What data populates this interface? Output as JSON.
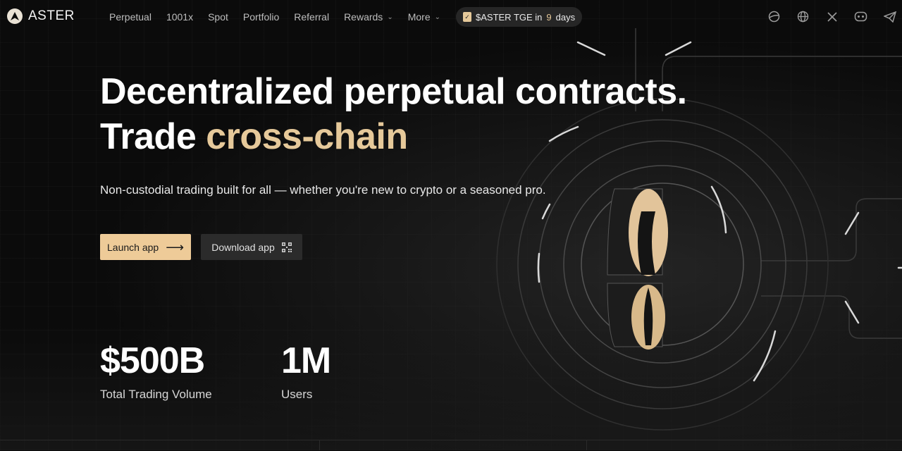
{
  "brand": {
    "name": "ASTER"
  },
  "nav": {
    "items": [
      {
        "label": "Perpetual"
      },
      {
        "label": "1001x"
      },
      {
        "label": "Spot"
      },
      {
        "label": "Portfolio"
      },
      {
        "label": "Referral"
      },
      {
        "label": "Rewards",
        "dropdown": true
      },
      {
        "label": "More",
        "dropdown": true
      }
    ],
    "tge": {
      "prefix": "$ASTER TGE in",
      "count": "9",
      "suffix": "days"
    },
    "icons": [
      "theme-icon",
      "globe-icon",
      "x-icon",
      "discord-icon",
      "telegram-icon"
    ]
  },
  "hero": {
    "line1": "Decentralized perpetual contracts.",
    "line2_prefix": "Trade",
    "line2_highlight": "cross-chain",
    "subtitle": "Non-custodial trading built for all — whether you're new to crypto or a seasoned pro.",
    "launch_label": "Launch app",
    "download_label": "Download app"
  },
  "stats": [
    {
      "value": "$500B",
      "label": "Total Trading Volume"
    },
    {
      "value": "1M",
      "label": "Users"
    }
  ],
  "colors": {
    "accent": "#eecb98",
    "gold_text": "#e6c99a",
    "background": "#0b0b0b"
  }
}
